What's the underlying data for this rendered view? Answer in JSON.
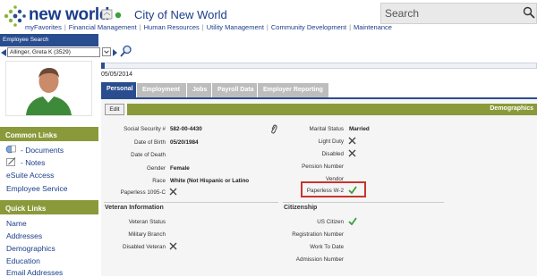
{
  "header": {
    "brand": "new world",
    "city": "City of New World",
    "search_placeholder": "Search",
    "nav": [
      "myFavorites",
      "Financial Management",
      "Human Resources",
      "Utility Management",
      "Community Development",
      "Maintenance"
    ]
  },
  "employee_search": {
    "title": "Employee Search",
    "selected": "Allinger, Greta K (3529)"
  },
  "sidebar": {
    "common_links_title": "Common Links",
    "common_links": [
      "- Documents",
      "- Notes",
      "eSuite Access",
      "Employee Service"
    ],
    "quick_links_title": "Quick Links",
    "quick_links": [
      "Name",
      "Addresses",
      "Demographics",
      "Education",
      "Email Addresses"
    ]
  },
  "date": "05/05/2014",
  "progress_fraction": 0.01,
  "tabs": [
    "Personal",
    "Employment",
    "Jobs",
    "Payroll Data",
    "Employer Reporting"
  ],
  "active_tab": "Personal",
  "edit_label": "Edit",
  "section_title": "Demographics",
  "left_fields": [
    {
      "label": "Social Security #",
      "value": "582-00-4430"
    },
    {
      "label": "Date of Birth",
      "value": "05/20/1984"
    },
    {
      "label": "Date of Death",
      "value": ""
    },
    {
      "label": "Gender",
      "value": "Female"
    },
    {
      "label": "Race",
      "value": "White (Not Hispanic or Latino"
    },
    {
      "label": "Paperless 1095-C",
      "value": ""
    }
  ],
  "right_fields": [
    {
      "label": "Marital Status",
      "value": "Married"
    },
    {
      "label": "Light Duty",
      "value": ""
    },
    {
      "label": "Disabled",
      "value": ""
    },
    {
      "label": "Pension Number",
      "value": ""
    },
    {
      "label": "Vendor",
      "value": ""
    },
    {
      "label": "Paperless W-2",
      "value": ""
    }
  ],
  "veteran": {
    "title": "Veteran Information",
    "fields": [
      "Veteran Status",
      "Military Branch",
      "Disabled Veteran"
    ]
  },
  "citizenship": {
    "title": "Citizenship",
    "fields": [
      "US Citizen",
      "Registration Number",
      "Work To Date",
      "Admission Number"
    ]
  },
  "colors": {
    "brand_blue": "#1b3d8a",
    "nav_blue": "#2a4d8f",
    "olive": "#8a9a3a",
    "highlight_red": "#c8352e",
    "check_green": "#3aa03a"
  }
}
